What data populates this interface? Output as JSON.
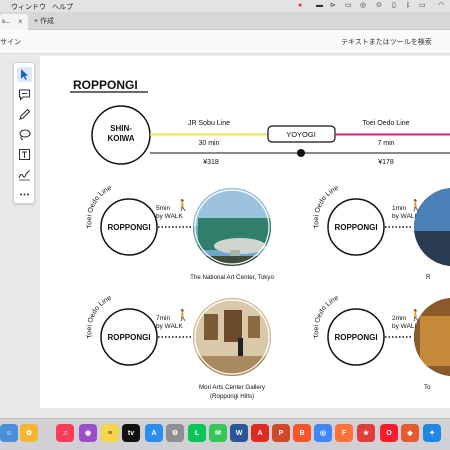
{
  "menubar": {
    "window": "ウィンドウ",
    "help": "ヘルプ"
  },
  "tab": {
    "label": "s...",
    "new_tab": "作成"
  },
  "toolbar": {
    "sign": "サイン",
    "search_label": "テキストまたはツールを検索"
  },
  "doc": {
    "title": "ROPPONGI",
    "top_route": {
      "origin": "SHIN-\nKOIWA",
      "transfer": "YOYOGI",
      "leg1": {
        "line": "JR Sobu Line",
        "time": "30 min",
        "fare": "¥318",
        "color": "#ece64b"
      },
      "leg2": {
        "line": "Toei Oedo Line",
        "time": "7 min",
        "fare": "¥178",
        "color": "#d5247d"
      }
    },
    "stations": [
      {
        "line": "Toei Oedo Line",
        "name": "ROPPONGI",
        "walk_min": "5min",
        "walk_by": "by WALK",
        "dest": "The National Art Center, Tokyo",
        "dest2": ""
      },
      {
        "line": "Toei Oedo Line",
        "name": "ROPPONGI",
        "walk_min": "1min",
        "walk_by": "by WALK",
        "dest": "R",
        "dest2": ""
      },
      {
        "line": "Toei Oedo Line",
        "name": "ROPPONGI",
        "walk_min": "7min",
        "walk_by": "by WALK",
        "dest": "Mori Arts Center Gallery",
        "dest2": "(Roppongi Hills)"
      },
      {
        "line": "Toei Oedo Line",
        "name": "ROPPONGI",
        "walk_min": "2min",
        "walk_by": "by WALK",
        "dest": "To",
        "dest2": ""
      }
    ]
  },
  "tools": [
    "select-arrow-icon",
    "comment-icon",
    "pen-icon",
    "lasso-icon",
    "text-box-icon",
    "signature-icon",
    "more-icon"
  ],
  "dock": [
    "finder-icon",
    "photos-icon",
    "music-icon",
    "podcasts-icon",
    "notes-icon",
    "tv-icon",
    "app-store-icon",
    "system-settings-icon",
    "line-icon",
    "messages-icon",
    "word-icon",
    "acrobat-icon",
    "powerpoint-icon",
    "brave-icon",
    "chrome-icon",
    "firefox-icon",
    "reeder-icon",
    "opera-icon",
    "safari-icon"
  ]
}
